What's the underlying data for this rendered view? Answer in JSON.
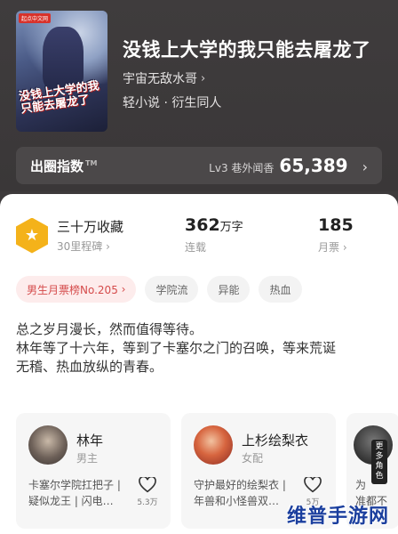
{
  "book": {
    "cover_badge": "起点中文网",
    "cover_title_art": "没钱上大学的我只能去屠龙了",
    "title": "没钱上大学的我只能去屠龙了",
    "author": "宇宙无敌水哥",
    "genre": "轻小说 · 衍生同人"
  },
  "heat": {
    "label": "出圈指数",
    "tm": "TM",
    "level": "Lv3 巷外闻香",
    "value": "65,389"
  },
  "stats": {
    "award_main": "三十万收藏",
    "award_sub": "30里程碑",
    "words_num": "362",
    "words_unit": "万字",
    "words_label": "连载",
    "ticket_num": "185",
    "ticket_label": "月票"
  },
  "tags": [
    "男生月票榜No.205",
    "学院流",
    "异能",
    "热血"
  ],
  "description": [
    "总之岁月漫长，然而值得等待。",
    "林年等了十六年，等到了卡塞尔之门的召唤，等来荒诞",
    "无稽、热血放纵的青春。"
  ],
  "characters": [
    {
      "name": "林年",
      "role": "男主",
      "desc": "卡塞尔学院扛把子 | 疑似龙王 | 闪电…",
      "likes": "5.3万"
    },
    {
      "name": "上杉绘梨衣",
      "role": "女配",
      "desc": "守护最好的绘梨衣 | 年兽和小怪兽双…",
      "likes": "5万"
    }
  ],
  "partial_card": {
    "badge": "更多角色",
    "text": "为\n准都不"
  },
  "watermark": "维普手游网"
}
